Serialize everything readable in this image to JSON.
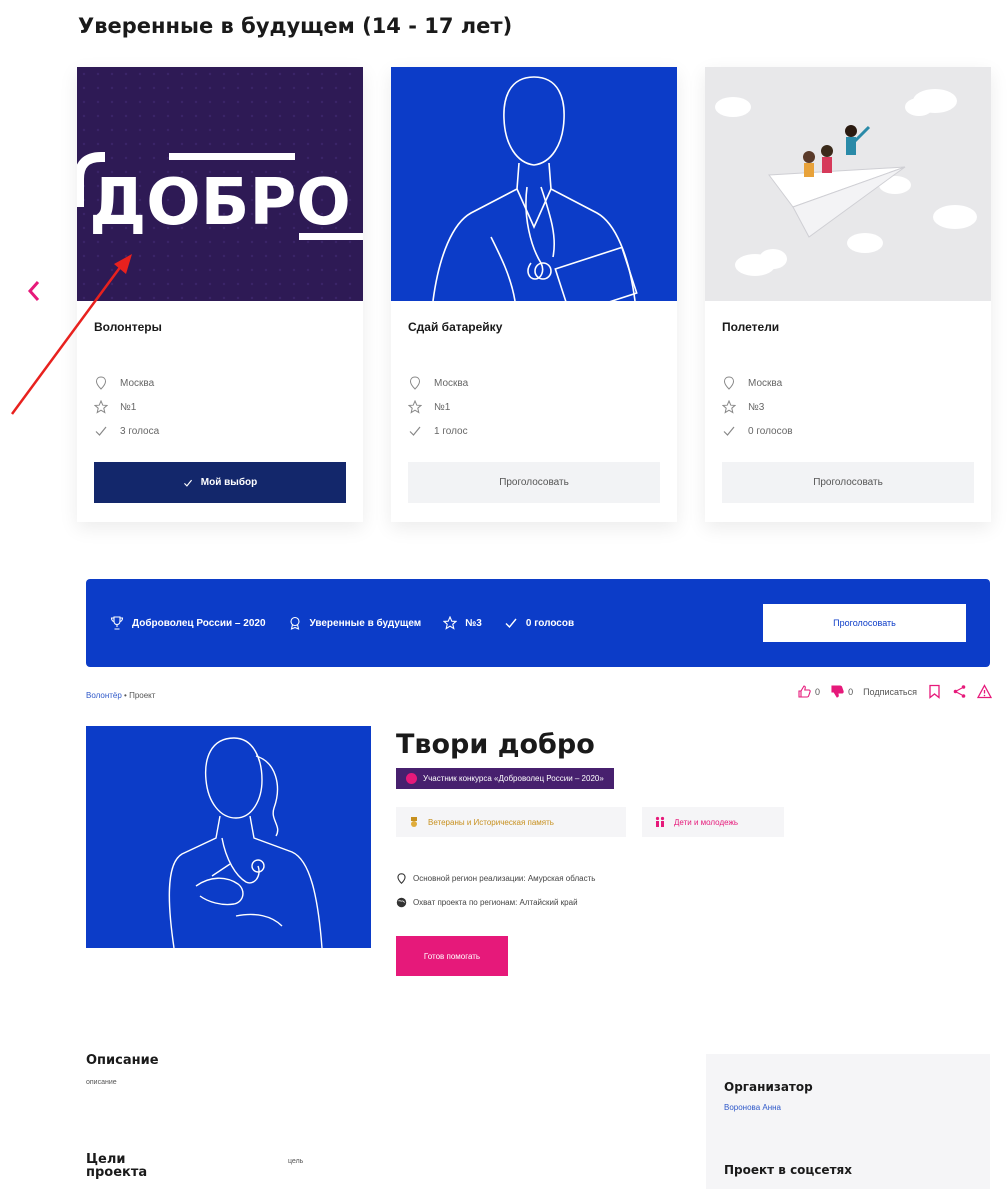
{
  "section": {
    "title": "Уверенные в будущем (14 - 17 лет)"
  },
  "carousel": {
    "cards": [
      {
        "image": "dobro-logo",
        "logo_text": "ДОБРО",
        "title": "Волонтеры",
        "city": "Москва",
        "number": "№1",
        "votes": "3 голоса",
        "button": "Мой выбор",
        "selected": true
      },
      {
        "image": "doctor-line-art",
        "title": "Сдай батарейку",
        "city": "Москва",
        "number": "№1",
        "votes": "1 голос",
        "button": "Проголосовать",
        "selected": false
      },
      {
        "image": "kids-on-paper-plane",
        "title": "Полетели",
        "city": "Москва",
        "number": "№3",
        "votes": "0 голосов",
        "button": "Проголосовать",
        "selected": false
      }
    ]
  },
  "banner": {
    "contest": "Доброволец России – 2020",
    "nomination": "Уверенные в будущем",
    "number": "№3",
    "votes": "0 голосов",
    "button": "Проголосовать"
  },
  "breadcrumb": {
    "root": "Волонтёр",
    "separator": "•",
    "current": "Проект"
  },
  "actions": {
    "likes": "0",
    "dislikes": "0",
    "subscribe": "Подписаться"
  },
  "project": {
    "title": "Твори добро",
    "badge": "Участник конкурса «Доброволец России – 2020»",
    "tags": [
      "Ветераны и Историческая память",
      "Дети и молодежь"
    ],
    "main_region": "Основной регион реализации: Амурская область",
    "coverage": "Охват проекта по регионам: Алтайский край",
    "help_button": "Готов помогать"
  },
  "description": {
    "title": "Описание",
    "text": "описание"
  },
  "goals": {
    "title": "Цели проекта",
    "text": "цель"
  },
  "sidebar": {
    "organizer_title": "Организатор",
    "organizer_name": "Воронова Анна",
    "social_title": "Проект в соцсетях"
  },
  "colors": {
    "primary_blue": "#0c3cc8",
    "dark_navy": "#13276b",
    "accent_pink": "#e6197a",
    "badge_purple": "#47206e",
    "dobro_purple": "#2e1a55"
  }
}
